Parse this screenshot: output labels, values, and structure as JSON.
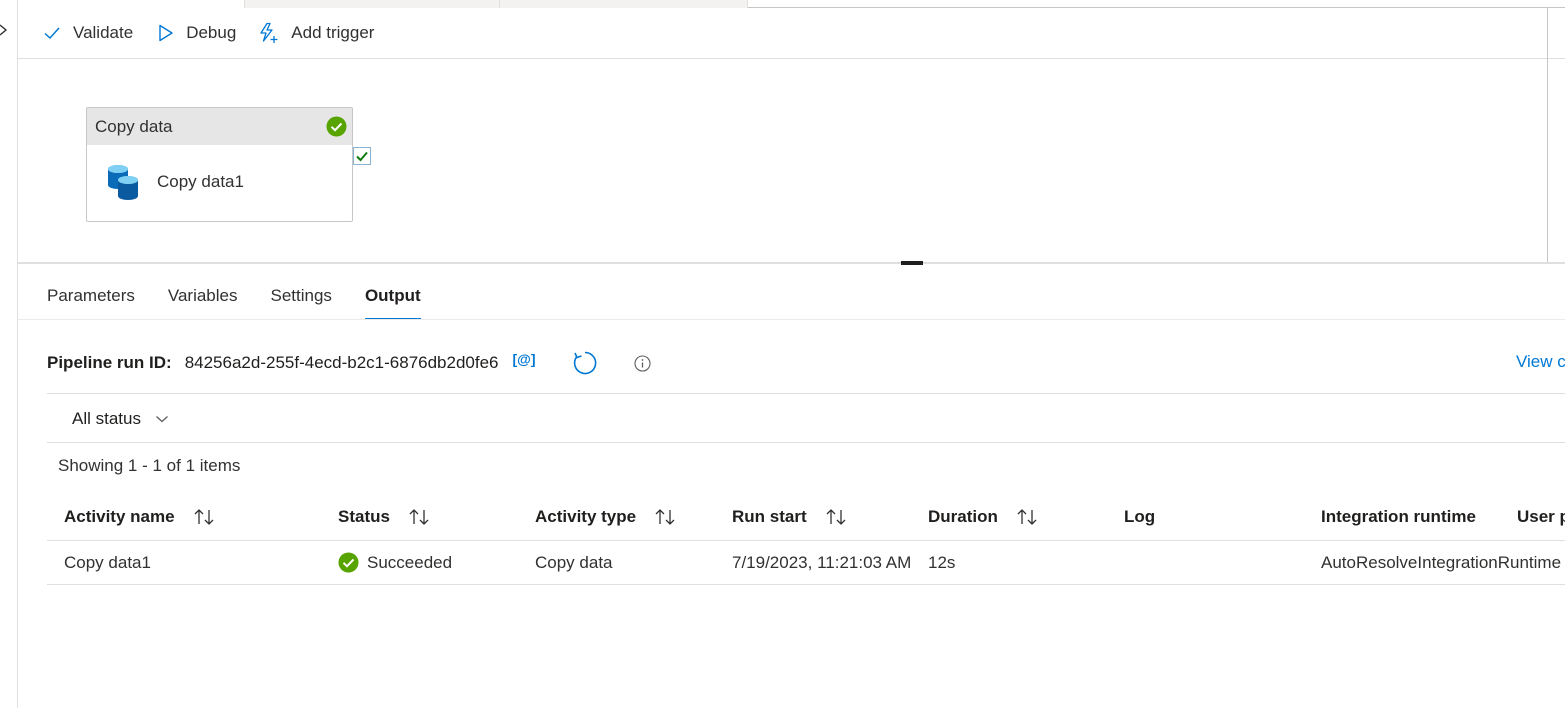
{
  "toolbar": {
    "validate_label": "Validate",
    "debug_label": "Debug",
    "add_trigger_label": "Add trigger"
  },
  "activity": {
    "type_label": "Copy data",
    "name": "Copy data1"
  },
  "panel": {
    "tabs": [
      {
        "label": "Parameters",
        "active": false
      },
      {
        "label": "Variables",
        "active": false
      },
      {
        "label": "Settings",
        "active": false
      },
      {
        "label": "Output",
        "active": true
      }
    ]
  },
  "output": {
    "run_id_label": "Pipeline run ID:",
    "run_id": "84256a2d-255f-4ecd-b2c1-6876db2d0fe6",
    "copy_icon_text": "[@]",
    "view_link": "View c",
    "status_filter": "All status",
    "showing": "Showing 1 - 1 of 1 items",
    "columns": [
      "Activity name",
      "Status",
      "Activity type",
      "Run start",
      "Duration",
      "Log",
      "Integration runtime",
      "User p"
    ],
    "rows": [
      {
        "activity_name": "Copy data1",
        "status": "Succeeded",
        "activity_type": "Copy data",
        "run_start": "7/19/2023, 11:21:03 AM",
        "duration": "12s",
        "log": "",
        "integration_runtime": "AutoResolveIntegrationRuntime"
      }
    ]
  },
  "colors": {
    "accent": "#0078d4",
    "success": "#57a300",
    "text": "#323130"
  },
  "icons": [
    "chevron-right-icon",
    "checkmark-icon",
    "play-icon",
    "trigger-icon",
    "success-icon",
    "database-copy-icon",
    "copy-icon",
    "refresh-icon",
    "info-icon",
    "chevron-down-icon",
    "sort-icon"
  ]
}
